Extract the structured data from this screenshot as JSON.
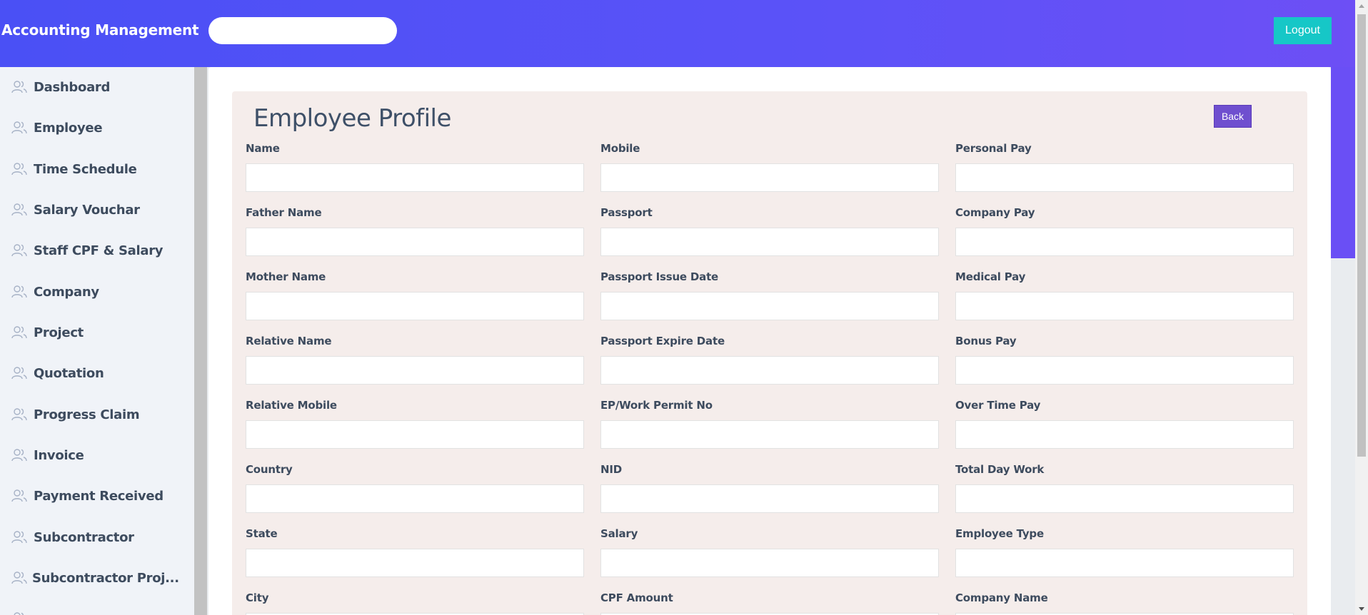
{
  "header": {
    "brand": "Accounting Management",
    "search_placeholder": "",
    "logout_label": "Logout"
  },
  "sidebar": {
    "items": [
      {
        "label": "Dashboard",
        "icon": "users-icon"
      },
      {
        "label": "Employee",
        "icon": "users-icon"
      },
      {
        "label": "Time Schedule",
        "icon": "users-icon"
      },
      {
        "label": "Salary Vouchar",
        "icon": "users-icon"
      },
      {
        "label": "Staff CPF & Salary",
        "icon": "users-icon"
      },
      {
        "label": "Company",
        "icon": "users-icon"
      },
      {
        "label": "Project",
        "icon": "users-icon"
      },
      {
        "label": "Quotation",
        "icon": "users-icon"
      },
      {
        "label": "Progress Claim",
        "icon": "users-icon"
      },
      {
        "label": "Invoice",
        "icon": "users-icon"
      },
      {
        "label": "Payment Received",
        "icon": "users-icon"
      },
      {
        "label": "Subcontractor",
        "icon": "users-icon"
      },
      {
        "label": "Subcontractor Proj...",
        "icon": "users-icon"
      }
    ]
  },
  "main": {
    "title": "Employee Profile",
    "back_label": "Back",
    "fields": [
      {
        "label": "Name",
        "value": ""
      },
      {
        "label": "Mobile",
        "value": ""
      },
      {
        "label": "Personal Pay",
        "value": ""
      },
      {
        "label": "Father Name",
        "value": ""
      },
      {
        "label": "Passport",
        "value": ""
      },
      {
        "label": "Company Pay",
        "value": ""
      },
      {
        "label": "Mother Name",
        "value": ""
      },
      {
        "label": "Passport Issue Date",
        "value": ""
      },
      {
        "label": "Medical Pay",
        "value": ""
      },
      {
        "label": "Relative Name",
        "value": ""
      },
      {
        "label": "Passport Expire Date",
        "value": ""
      },
      {
        "label": "Bonus Pay",
        "value": ""
      },
      {
        "label": "Relative Mobile",
        "value": ""
      },
      {
        "label": "EP/Work Permit No",
        "value": ""
      },
      {
        "label": "Over Time Pay",
        "value": ""
      },
      {
        "label": "Country",
        "value": ""
      },
      {
        "label": "NID",
        "value": ""
      },
      {
        "label": "Total Day Work",
        "value": ""
      },
      {
        "label": "State",
        "value": ""
      },
      {
        "label": "Salary",
        "value": ""
      },
      {
        "label": "Employee Type",
        "value": ""
      },
      {
        "label": "City",
        "value": ""
      },
      {
        "label": "CPF Amount",
        "value": ""
      },
      {
        "label": "Company Name",
        "value": ""
      }
    ]
  },
  "colors": {
    "header_gradient_start": "#4a50f5",
    "header_gradient_end": "#6d4ff5",
    "logout_bg": "#16c7c7",
    "back_bg": "#6f4fcf",
    "panel_bg": "#f5edeb",
    "sidebar_bg": "#f0f3f8"
  }
}
